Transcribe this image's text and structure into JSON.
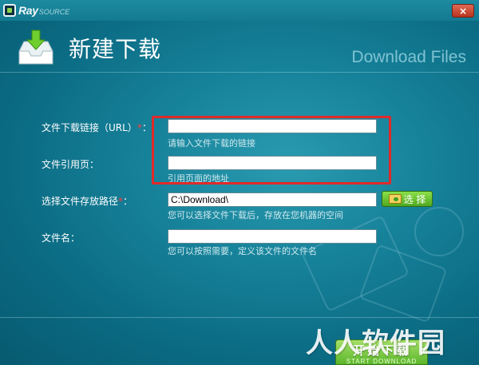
{
  "app": {
    "logo_text": "Ray",
    "logo_sub": "SOURCE",
    "close_label": "×"
  },
  "header": {
    "title": "新建下载",
    "subtitle": "Download Files",
    "icon": "download-tray-icon"
  },
  "form": {
    "url": {
      "label": "文件下载链接（URL）",
      "required_mark": "*",
      "colon": "：",
      "value": "",
      "hint": "请输入文件下载的链接"
    },
    "referrer": {
      "label": "文件引用页：",
      "value": "",
      "hint": "引用页面的地址"
    },
    "save_path": {
      "label": "选择文件存放路径",
      "required_mark": "*",
      "colon": "：",
      "value": "C:\\Download\\",
      "hint": "您可以选择文件下载后，存放在您机器的空间",
      "select_label": "选 择"
    },
    "filename": {
      "label": "文件名：",
      "value": "",
      "hint": "您可以按照需要，定义该文件的文件名"
    }
  },
  "footer": {
    "start_label": "开始下载",
    "start_sub": "START DOWNLOAD",
    "watermark": "人人软件园"
  },
  "colors": {
    "highlight": "#e02a2a",
    "accent_green": "#5bb62a",
    "background": "#16829a"
  }
}
